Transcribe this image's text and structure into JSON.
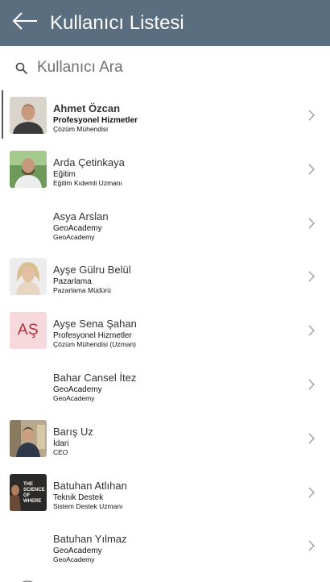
{
  "header": {
    "title": "Kullanıcı Listesi",
    "back_icon": "arrow-left-icon",
    "background_color": "#5b6e80"
  },
  "search": {
    "placeholder": "Kullanıcı Ara",
    "value": "",
    "icon": "search-icon"
  },
  "users": [
    {
      "name": "Ahmet Özcan",
      "department": "Profesyonel Hizmetler",
      "title": "Çözüm Mühendisi",
      "avatar": "photo",
      "selected": true
    },
    {
      "name": "Arda Çetinkaya",
      "department": "Eğitim",
      "title": "Eğitim Kıdemli Uzmanı",
      "avatar": "photo",
      "selected": false
    },
    {
      "name": "Asya Arslan",
      "department": "GeoAcademy",
      "title": "GeoAcademy",
      "avatar": "none",
      "selected": false
    },
    {
      "name": "Ayşe Gülru Belül",
      "department": "Pazarlama",
      "title": "Pazarlama Müdürü",
      "avatar": "photo",
      "selected": false
    },
    {
      "name": "Ayşe Sena Şahan",
      "department": "Profesyonel Hizmetler",
      "title": "Çözüm Mühendisi (Uzman)",
      "avatar": "initials",
      "initials": "AŞ",
      "selected": false
    },
    {
      "name": "Bahar Cansel İtez",
      "department": "GeoAcademy",
      "title": "GeoAcademy",
      "avatar": "none",
      "selected": false
    },
    {
      "name": "Barış Uz",
      "department": "İdari",
      "title": "CEO",
      "avatar": "photo",
      "selected": false
    },
    {
      "name": "Batuhan Atlıhan",
      "department": "Teknik Destek",
      "title": "Sistem Destek Uzmanı",
      "avatar": "photo",
      "selected": false
    },
    {
      "name": "Batuhan Yılmaz",
      "department": "GeoAcademy",
      "title": "GeoAcademy",
      "avatar": "none",
      "selected": false
    }
  ],
  "avatar_photo_text": [
    "THE",
    "SCIENCE",
    "OF",
    "WHERE"
  ],
  "colors": {
    "initials_background": "#f7d9dd",
    "initials_text": "#a8323f",
    "chevron": "#9a9a9a"
  }
}
